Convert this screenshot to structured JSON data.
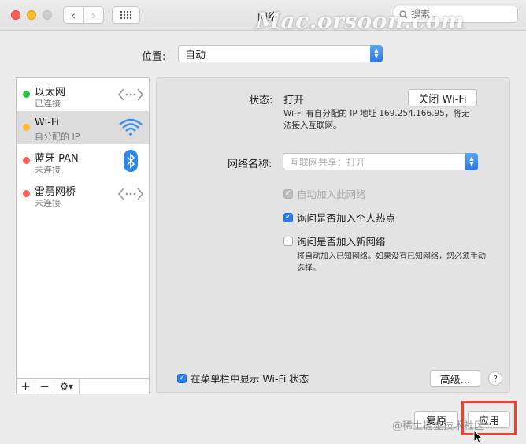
{
  "window": {
    "title": "网络",
    "search_placeholder": "搜索",
    "watermark": "Mac.orsoon.com"
  },
  "location": {
    "label": "位置:",
    "value": "自动"
  },
  "services": [
    {
      "name": "以太网",
      "status": "已连接",
      "status_color": "#28c840",
      "icon": "ethernet-icon",
      "selected": false
    },
    {
      "name": "Wi-Fi",
      "status": "自分配的 IP",
      "status_color": "#febc2e",
      "icon": "wifi-icon",
      "selected": true
    },
    {
      "name": "蓝牙 PAN",
      "status": "未连接",
      "status_color": "#fe5f57",
      "icon": "bluetooth-icon",
      "selected": false
    },
    {
      "name": "雷雳网桥",
      "status": "未连接",
      "status_color": "#fe5f57",
      "icon": "thunderbolt-bridge-icon",
      "selected": false
    }
  ],
  "sidebar_tools": {
    "add": "+",
    "remove": "−",
    "gear": "⚙▾"
  },
  "detail": {
    "status_label": "状态:",
    "status_value": "打开",
    "turn_off_button": "关闭 Wi-Fi",
    "status_description": "Wi-Fi 有自分配的 IP 地址 169.254.166.95，将无法接入互联网。",
    "network_name_label": "网络名称:",
    "network_name_value": "互联网共享：打开",
    "auto_join": {
      "label": "自动加入此网络",
      "checked": true,
      "enabled": false
    },
    "ask_hotspot": {
      "label": "询问是否加入个人热点",
      "checked": true,
      "enabled": true
    },
    "ask_new_network": {
      "label": "询问是否加入新网络",
      "checked": false,
      "enabled": true
    },
    "new_network_description": "将自动加入已知网络。如果没有已知网络，您必须手动选择。",
    "menubar": {
      "label": "在菜单栏中显示 Wi-Fi 状态",
      "checked": true
    },
    "advanced_button": "高级...",
    "help_button": "?"
  },
  "footer": {
    "revert_button": "复原",
    "apply_button": "应用",
    "credit": "@稀土掘金技术社区"
  },
  "colors": {
    "accent": "#2a7df0",
    "highlight": "#ea4335"
  }
}
